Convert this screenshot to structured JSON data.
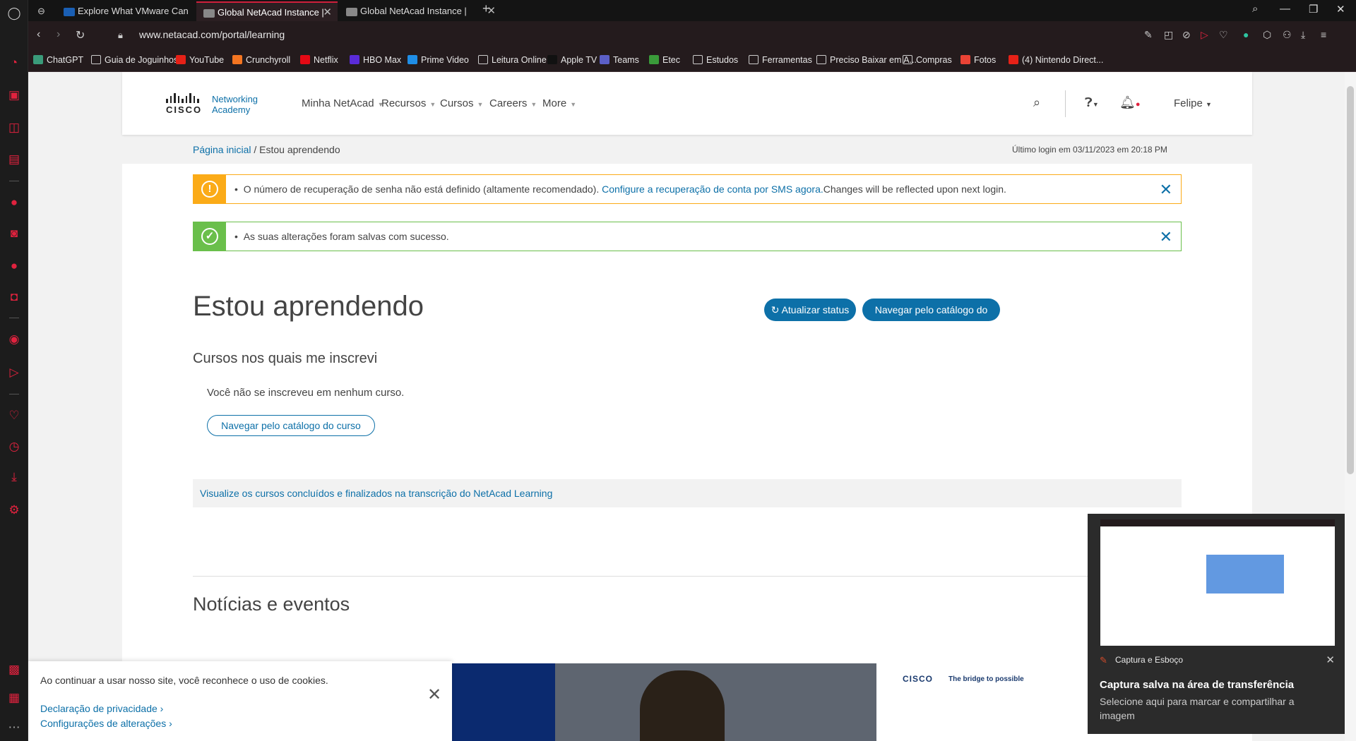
{
  "browser": {
    "tabs": [
      {
        "title": "Explore What VMware Can",
        "favicon_color": "#1a5fb4"
      },
      {
        "title": "Global NetAcad Instance | ",
        "favicon_color": "#aaaaaa"
      },
      {
        "title": "Global NetAcad Instance | ",
        "favicon_color": "#aaaaaa"
      }
    ],
    "url": "www.netacad.com/portal/learning",
    "bookmarks": [
      {
        "label": "ChatGPT",
        "color": "#3a9b7a"
      },
      {
        "label": "Guia de Joguinhos",
        "color": "folder"
      },
      {
        "label": "YouTube",
        "color": "#e62117"
      },
      {
        "label": "Crunchyroll",
        "color": "#f47521"
      },
      {
        "label": "Netflix",
        "color": "#e50914"
      },
      {
        "label": "HBO Max",
        "color": "#5a2bd8"
      },
      {
        "label": "Prime Video",
        "color": "#1f8ee6"
      },
      {
        "label": "Leitura Online",
        "color": "folder"
      },
      {
        "label": "Apple TV",
        "color": "#111111"
      },
      {
        "label": "Teams",
        "color": "#5b5fc7"
      },
      {
        "label": "Etec",
        "color": "#3a9b3a"
      },
      {
        "label": "Estudos",
        "color": "folder"
      },
      {
        "label": "Ferramentas",
        "color": "folder"
      },
      {
        "label": "Preciso Baixar em A...",
        "color": "folder"
      },
      {
        "label": "Compras",
        "color": "folder"
      },
      {
        "label": "Fotos",
        "color": "#ea4335"
      },
      {
        "label": "(4) Nintendo Direct...",
        "color": "#e62117"
      }
    ]
  },
  "header": {
    "logo_line1": "Networking",
    "logo_line2": "Academy",
    "cisco_word": "CISCO",
    "menu": [
      "Minha NetAcad",
      "Recursos",
      "Cursos",
      "Careers",
      "More"
    ],
    "user": "Felipe"
  },
  "breadcrumb": {
    "home": "Página inicial",
    "separator": "/",
    "current": "Estou aprendendo"
  },
  "last_login": "Último login em 03/11/2023 em 20:18 PM",
  "alerts": {
    "warning": {
      "text": "O número de recuperação de senha não está definido (altamente recomendado).",
      "link": "Configure a recuperação de conta por SMS agora.",
      "suffix": "Changes will be reflected upon next login.",
      "color": "#fbab18"
    },
    "success": {
      "text": "As suas alterações foram salvas com sucesso.",
      "color": "#6abf4b"
    }
  },
  "main": {
    "title": "Estou aprendendo",
    "refresh_button": "Atualizar status",
    "catalog_button": "Navegar pelo catálogo do curso",
    "enrolled_heading": "Cursos nos quais me inscrevi",
    "no_courses": "Você não se inscreveu em nenhum curso.",
    "catalog_link_button": "Navegar pelo catálogo do curso",
    "transcript_link": "Visualize os cursos concluídos e finalizados na transcrição do NetAcad Learning",
    "news_heading": "Notícias e eventos",
    "news_tagline": "The bridge to possible",
    "accent": "#0d70a8"
  },
  "cookie_banner": {
    "text": "Ao continuar a usar nosso site, você reconhece o uso de cookies.",
    "privacy_link": "Declaração de privacidade",
    "settings_link": "Configurações de alterações"
  },
  "toast": {
    "app": "Captura e Esboço",
    "title": "Captura salva na área de transferência",
    "subtitle": "Selecione aqui para marcar e compartilhar a imagem"
  }
}
